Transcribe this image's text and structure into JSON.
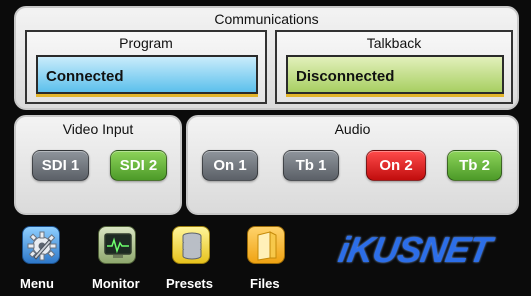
{
  "communications": {
    "title": "Communications",
    "program": {
      "label": "Program",
      "status": "Connected",
      "color": "#7fd0f2"
    },
    "talkback": {
      "label": "Talkback",
      "status": "Disconnected",
      "color": "#c4df84"
    }
  },
  "video_input": {
    "title": "Video Input",
    "buttons": [
      {
        "label": "SDI 1",
        "state": "gray"
      },
      {
        "label": "SDI 2",
        "state": "green"
      }
    ]
  },
  "audio": {
    "title": "Audio",
    "buttons": [
      {
        "label": "On 1",
        "state": "gray"
      },
      {
        "label": "Tb 1",
        "state": "gray"
      },
      {
        "label": "On 2",
        "state": "red"
      },
      {
        "label": "Tb 2",
        "state": "green"
      }
    ]
  },
  "dock": {
    "items": [
      {
        "label": "Menu",
        "icon": "gear-icon"
      },
      {
        "label": "Monitor",
        "icon": "monitor-icon"
      },
      {
        "label": "Presets",
        "icon": "database-icon"
      },
      {
        "label": "Files",
        "icon": "folder-icon"
      }
    ]
  },
  "brand": {
    "logo_text": "iKUSNET",
    "color": "#2c6ee8"
  }
}
